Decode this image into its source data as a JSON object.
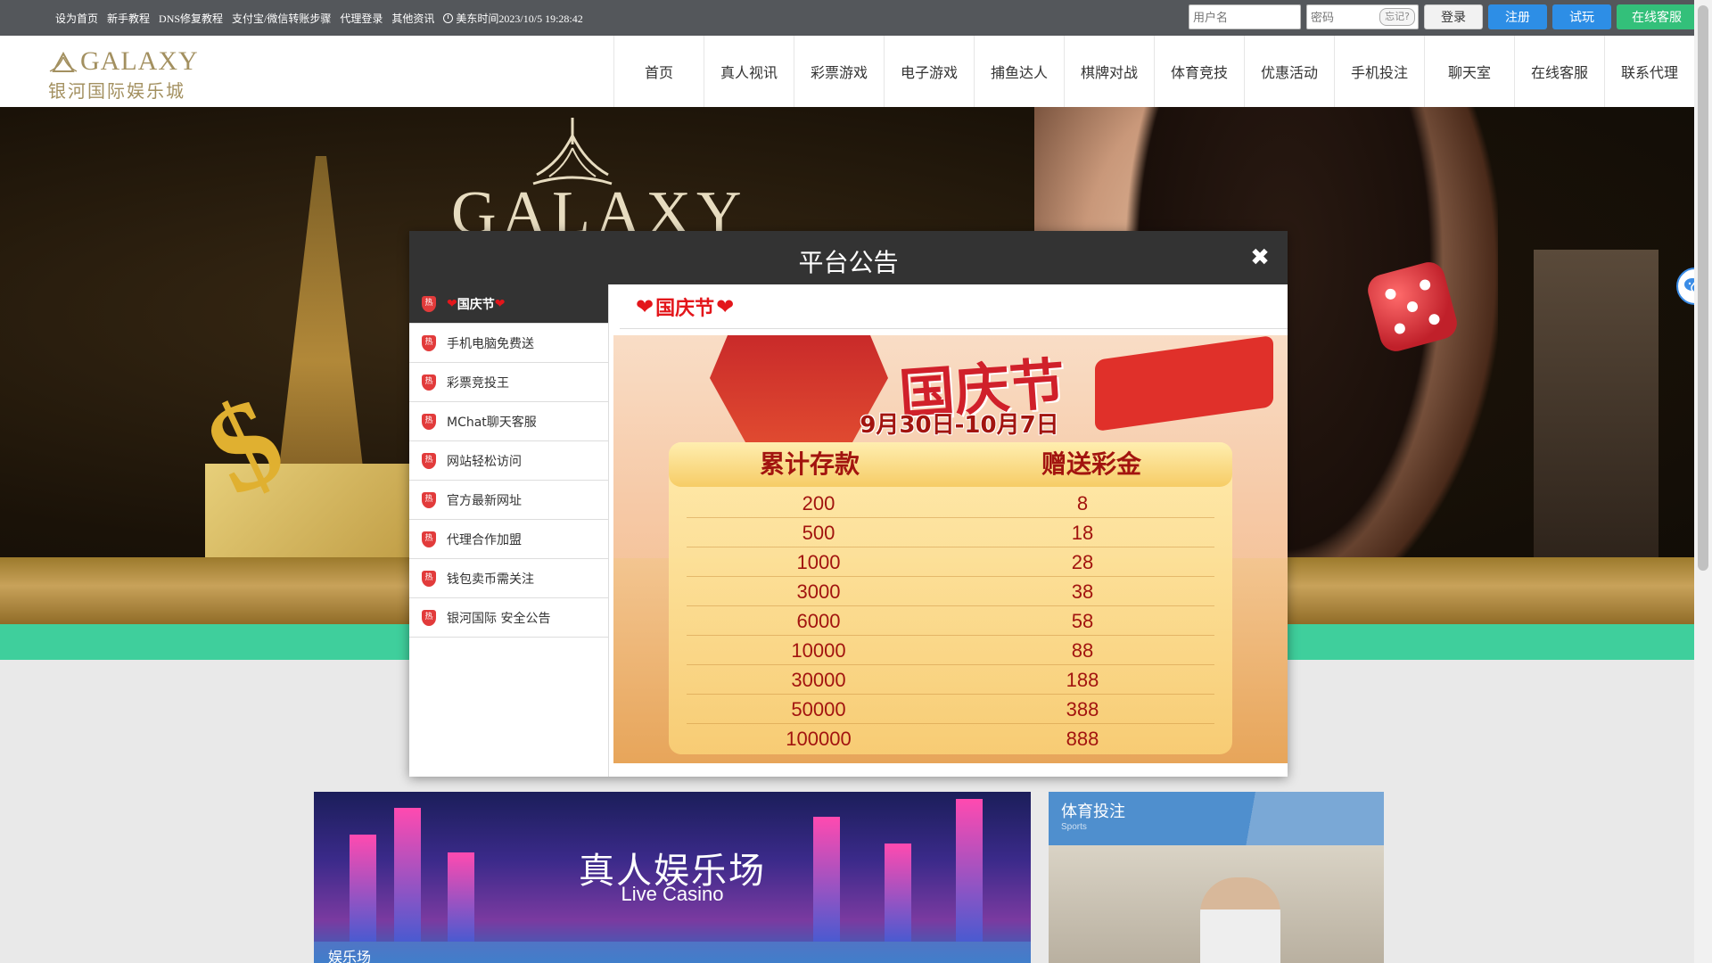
{
  "topbar": {
    "links": [
      "设为首页",
      "新手教程",
      "DNS修复教程",
      "支付宝/微信转账步骤",
      "代理登录",
      "其他资讯"
    ],
    "clock": "美东时间2023/10/5 19:28:42",
    "username_placeholder": "用户名",
    "password_placeholder": "密码",
    "forgot_label": "忘记?",
    "login_label": "登录",
    "register_label": "注册",
    "trial_label": "试玩",
    "service_label": "在线客服"
  },
  "header": {
    "logo_en": "GALAXY",
    "logo_cn": "银河国际娱乐城",
    "nav": [
      "首页",
      "真人视讯",
      "彩票游戏",
      "电子游戏",
      "捕鱼达人",
      "棋牌对战",
      "体育竞技",
      "优惠活动",
      "手机投注",
      "聊天室",
      "在线客服",
      "联系代理"
    ]
  },
  "banner": {
    "logo_text": "GALAXY"
  },
  "modal": {
    "title": "平台公告",
    "close_symbol": "✖",
    "hot_badge": "热",
    "items": [
      {
        "label": "国庆节",
        "active": true
      },
      {
        "label": "手机电脑免费送",
        "active": false
      },
      {
        "label": "彩票竞投王",
        "active": false
      },
      {
        "label": "MChat聊天客服",
        "active": false
      },
      {
        "label": "网站轻松访问",
        "active": false
      },
      {
        "label": "官方最新网址",
        "active": false
      },
      {
        "label": "代理合作加盟",
        "active": false
      },
      {
        "label": "钱包卖币需关注",
        "active": false
      },
      {
        "label": "银河国际 安全公告",
        "active": false
      }
    ],
    "content_title": "国庆节",
    "heart": "❤",
    "poster": {
      "festival": "国庆节",
      "dates": "9月30日-10月7日",
      "col_deposit": "累计存款",
      "col_bonus": "赠送彩金",
      "rows": [
        [
          "200",
          "8"
        ],
        [
          "500",
          "18"
        ],
        [
          "1000",
          "28"
        ],
        [
          "3000",
          "38"
        ],
        [
          "6000",
          "58"
        ],
        [
          "10000",
          "88"
        ],
        [
          "30000",
          "188"
        ],
        [
          "50000",
          "388"
        ],
        [
          "100000",
          "888"
        ]
      ]
    }
  },
  "lower": {
    "live_casino_title": "真人娱乐场",
    "live_casino_sub": "Live Casino",
    "live_casino_footer": "娱乐场",
    "sports_title": "体育投注",
    "sports_sub": "Sports"
  }
}
